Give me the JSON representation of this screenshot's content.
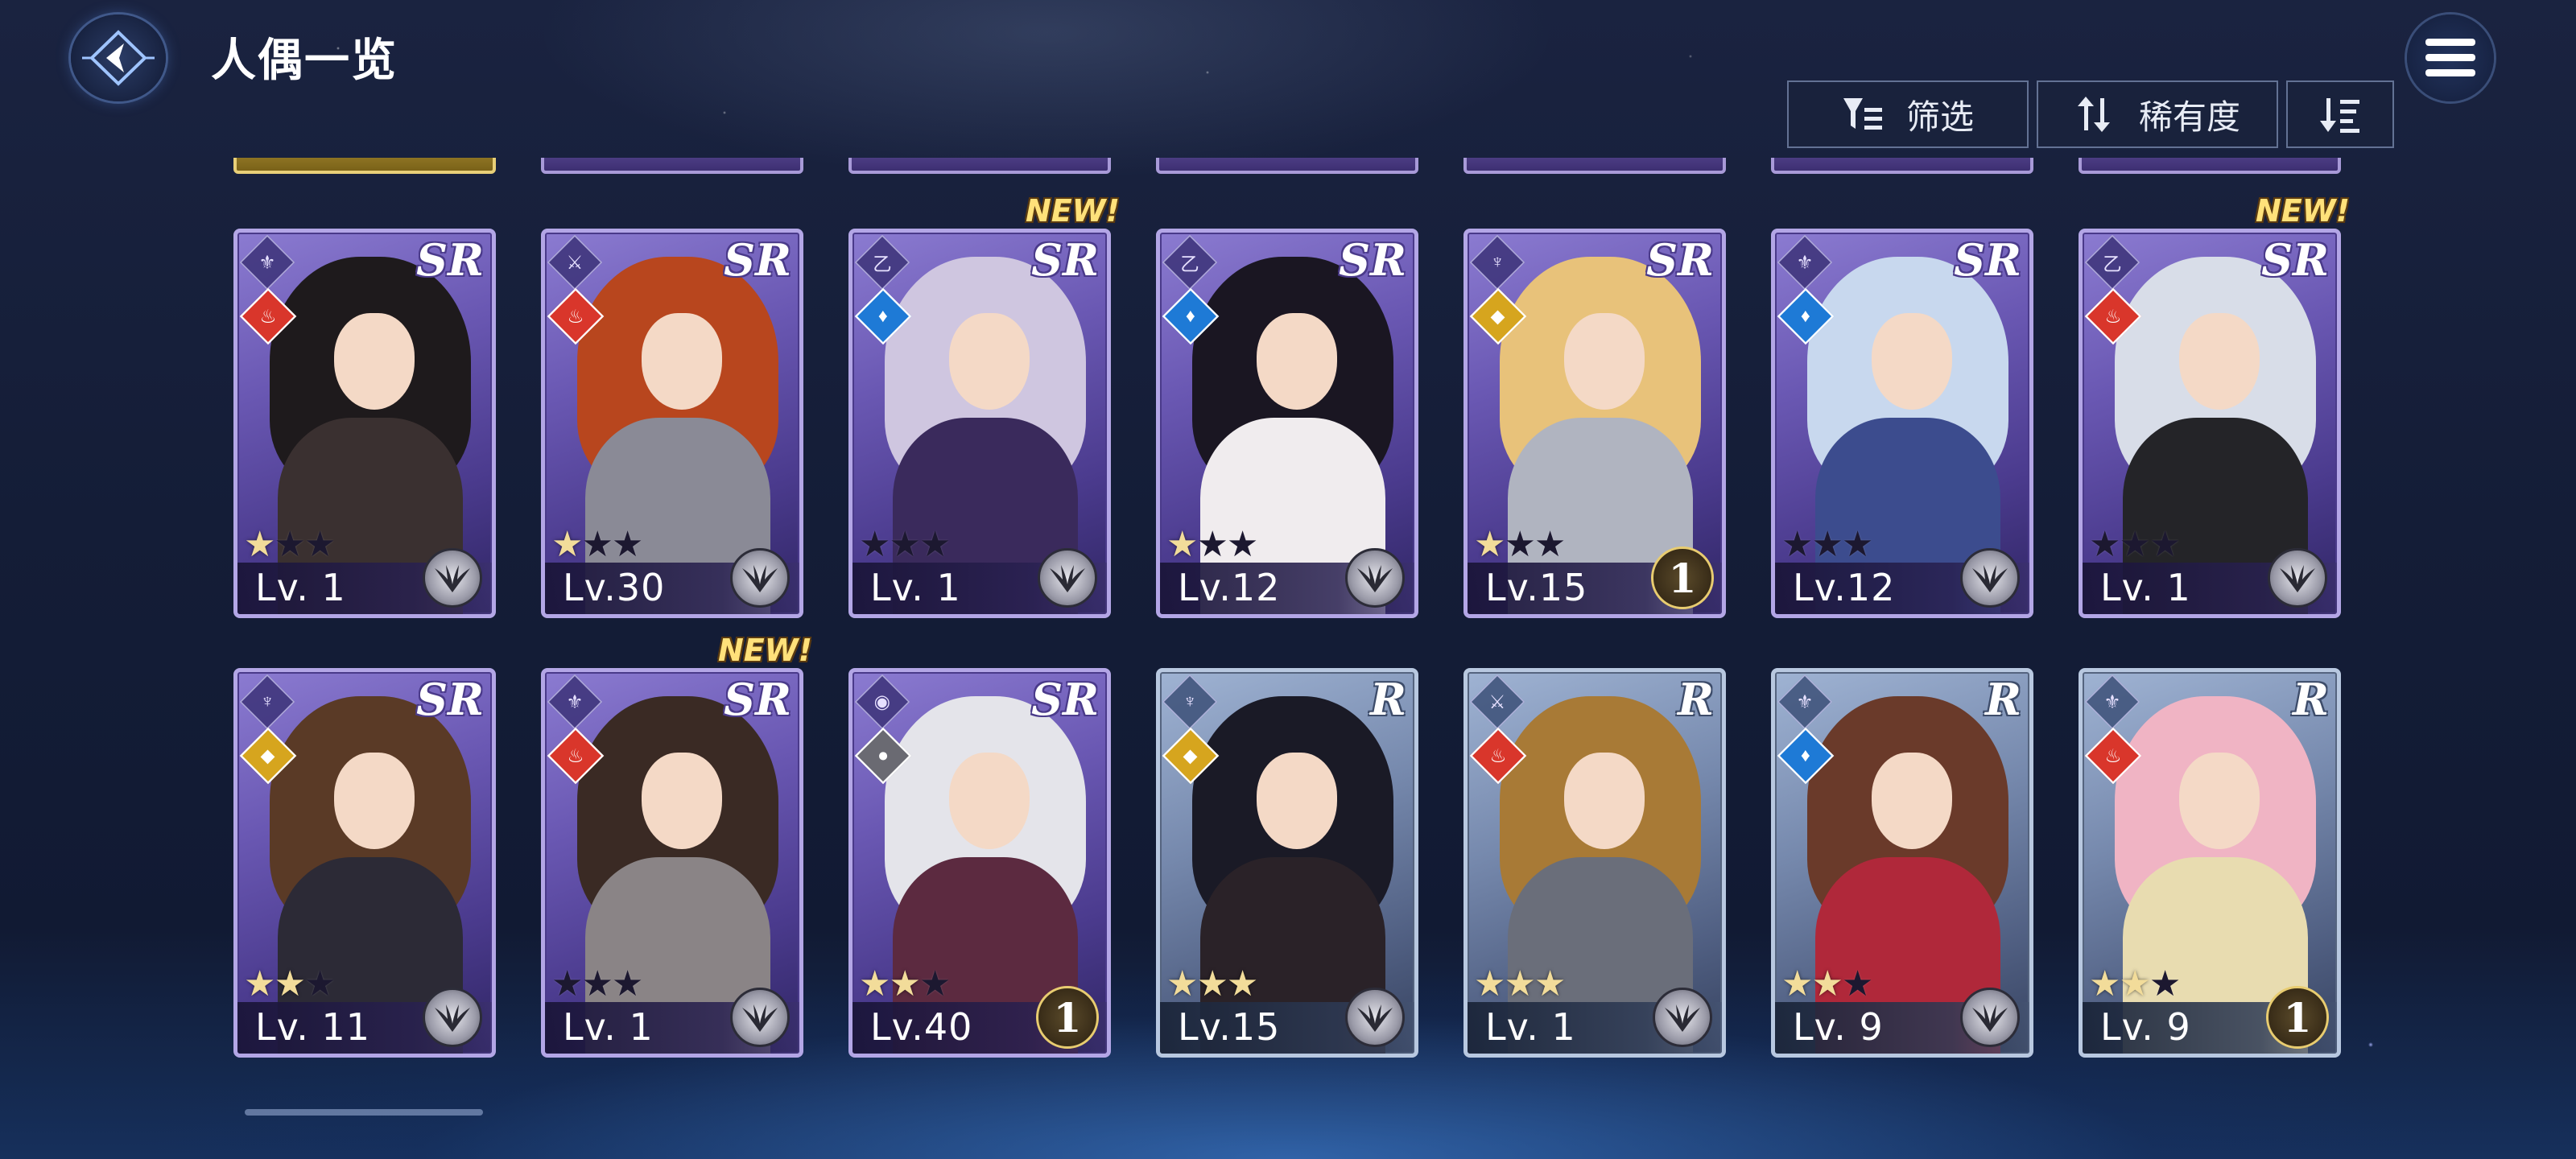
{
  "header": {
    "title": "人偶一览"
  },
  "toolbar": {
    "filter_label": "筛选",
    "rarity_label": "稀有度"
  },
  "cards": [
    {
      "rarity": "SR",
      "level": "Lv. 1",
      "stars": 1,
      "element": "fire",
      "element_color": "#d9362b",
      "class_glyph": "⚜",
      "rank": "",
      "new": false,
      "hair": "#1e1a1c",
      "body": "#3a3030"
    },
    {
      "rarity": "SR",
      "level": "Lv.30",
      "stars": 1,
      "element": "fire",
      "element_color": "#d9362b",
      "class_glyph": "⚔",
      "rank": "",
      "new": false,
      "hair": "#b8461e",
      "body": "#8a8a96"
    },
    {
      "rarity": "SR",
      "level": "Lv. 1",
      "stars": 0,
      "element": "water",
      "element_color": "#1e7ad6",
      "class_glyph": "乙",
      "rank": "",
      "new": true,
      "hair": "#cfc6e0",
      "body": "#3a2a5c"
    },
    {
      "rarity": "SR",
      "level": "Lv.12",
      "stars": 1,
      "element": "water",
      "element_color": "#1e7ad6",
      "class_glyph": "乙",
      "rank": "",
      "new": false,
      "hair": "#1a1622",
      "body": "#f0ecee"
    },
    {
      "rarity": "SR",
      "level": "Lv.15",
      "stars": 1,
      "element": "earth",
      "element_color": "#d6a51e",
      "class_glyph": "♆",
      "rank": "1",
      "new": false,
      "hair": "#e8c27a",
      "body": "#b0b4c0"
    },
    {
      "rarity": "SR",
      "level": "Lv.12",
      "stars": 0,
      "element": "water",
      "element_color": "#1e7ad6",
      "class_glyph": "⚜",
      "rank": "",
      "new": false,
      "hair": "#c8d8ee",
      "body": "#3c4c8e"
    },
    {
      "rarity": "SR",
      "level": "Lv. 1",
      "stars": 0,
      "element": "fire",
      "element_color": "#d9362b",
      "class_glyph": "乙",
      "rank": "",
      "new": true,
      "hair": "#d8dde8",
      "body": "#242428"
    },
    {
      "rarity": "SR",
      "level": "Lv. 11",
      "stars": 2,
      "element": "earth",
      "element_color": "#d6a51e",
      "class_glyph": "♆",
      "rank": "",
      "new": false,
      "hair": "#5a3a26",
      "body": "#2c2a36"
    },
    {
      "rarity": "SR",
      "level": "Lv. 1",
      "stars": 0,
      "element": "fire",
      "element_color": "#d9362b",
      "class_glyph": "⚜",
      "rank": "",
      "new": true,
      "hair": "#3a2a24",
      "body": "#8a8486"
    },
    {
      "rarity": "SR",
      "level": "Lv.40",
      "stars": 2,
      "element": "shadow",
      "element_color": "#6a6a72",
      "class_glyph": "◉",
      "rank": "1",
      "new": false,
      "hair": "#e4e4ea",
      "body": "#5c2a40"
    },
    {
      "rarity": "R",
      "level": "Lv.15",
      "stars": 3,
      "element": "earth",
      "element_color": "#d6a51e",
      "class_glyph": "♆",
      "rank": "",
      "new": false,
      "hair": "#1a1a26",
      "body": "#2a2228"
    },
    {
      "rarity": "R",
      "level": "Lv. 1",
      "stars": 3,
      "element": "fire",
      "element_color": "#d9362b",
      "class_glyph": "⚔",
      "rank": "",
      "new": false,
      "hair": "#a87a36",
      "body": "#6a6e7a"
    },
    {
      "rarity": "R",
      "level": "Lv. 9",
      "stars": 2,
      "element": "water",
      "element_color": "#1e7ad6",
      "class_glyph": "⚜",
      "rank": "",
      "new": false,
      "hair": "#6a3a2a",
      "body": "#b0283a"
    },
    {
      "rarity": "R",
      "level": "Lv. 9",
      "stars": 2,
      "element": "fire",
      "element_color": "#d9362b",
      "class_glyph": "⚜",
      "rank": "1",
      "new": false,
      "hair": "#f0b4c4",
      "body": "#e8dcb0"
    }
  ],
  "new_label": "NEW!",
  "colors": {
    "sr_frame": "#b3a6e6",
    "r_frame": "#b8c8e0",
    "star_on": "#f2dc9a",
    "new_text": "#ffe17a"
  }
}
